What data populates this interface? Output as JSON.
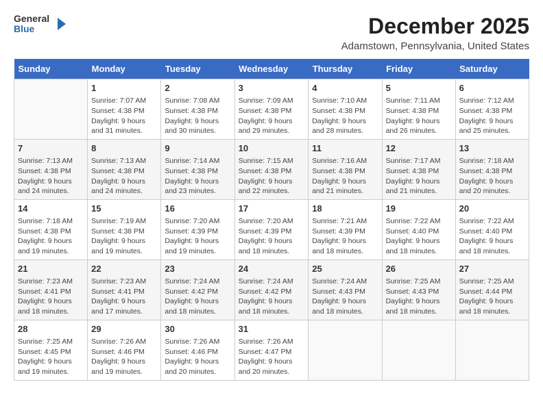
{
  "header": {
    "logo_general": "General",
    "logo_blue": "Blue",
    "title": "December 2025",
    "subtitle": "Adamstown, Pennsylvania, United States"
  },
  "days_of_week": [
    "Sunday",
    "Monday",
    "Tuesday",
    "Wednesday",
    "Thursday",
    "Friday",
    "Saturday"
  ],
  "weeks": [
    [
      {
        "day": "",
        "sunrise": "",
        "sunset": "",
        "daylight": ""
      },
      {
        "day": "1",
        "sunrise": "Sunrise: 7:07 AM",
        "sunset": "Sunset: 4:38 PM",
        "daylight": "Daylight: 9 hours and 31 minutes."
      },
      {
        "day": "2",
        "sunrise": "Sunrise: 7:08 AM",
        "sunset": "Sunset: 4:38 PM",
        "daylight": "Daylight: 9 hours and 30 minutes."
      },
      {
        "day": "3",
        "sunrise": "Sunrise: 7:09 AM",
        "sunset": "Sunset: 4:38 PM",
        "daylight": "Daylight: 9 hours and 29 minutes."
      },
      {
        "day": "4",
        "sunrise": "Sunrise: 7:10 AM",
        "sunset": "Sunset: 4:38 PM",
        "daylight": "Daylight: 9 hours and 28 minutes."
      },
      {
        "day": "5",
        "sunrise": "Sunrise: 7:11 AM",
        "sunset": "Sunset: 4:38 PM",
        "daylight": "Daylight: 9 hours and 26 minutes."
      },
      {
        "day": "6",
        "sunrise": "Sunrise: 7:12 AM",
        "sunset": "Sunset: 4:38 PM",
        "daylight": "Daylight: 9 hours and 25 minutes."
      }
    ],
    [
      {
        "day": "7",
        "sunrise": "Sunrise: 7:13 AM",
        "sunset": "Sunset: 4:38 PM",
        "daylight": "Daylight: 9 hours and 24 minutes."
      },
      {
        "day": "8",
        "sunrise": "Sunrise: 7:13 AM",
        "sunset": "Sunset: 4:38 PM",
        "daylight": "Daylight: 9 hours and 24 minutes."
      },
      {
        "day": "9",
        "sunrise": "Sunrise: 7:14 AM",
        "sunset": "Sunset: 4:38 PM",
        "daylight": "Daylight: 9 hours and 23 minutes."
      },
      {
        "day": "10",
        "sunrise": "Sunrise: 7:15 AM",
        "sunset": "Sunset: 4:38 PM",
        "daylight": "Daylight: 9 hours and 22 minutes."
      },
      {
        "day": "11",
        "sunrise": "Sunrise: 7:16 AM",
        "sunset": "Sunset: 4:38 PM",
        "daylight": "Daylight: 9 hours and 21 minutes."
      },
      {
        "day": "12",
        "sunrise": "Sunrise: 7:17 AM",
        "sunset": "Sunset: 4:38 PM",
        "daylight": "Daylight: 9 hours and 21 minutes."
      },
      {
        "day": "13",
        "sunrise": "Sunrise: 7:18 AM",
        "sunset": "Sunset: 4:38 PM",
        "daylight": "Daylight: 9 hours and 20 minutes."
      }
    ],
    [
      {
        "day": "14",
        "sunrise": "Sunrise: 7:18 AM",
        "sunset": "Sunset: 4:38 PM",
        "daylight": "Daylight: 9 hours and 19 minutes."
      },
      {
        "day": "15",
        "sunrise": "Sunrise: 7:19 AM",
        "sunset": "Sunset: 4:38 PM",
        "daylight": "Daylight: 9 hours and 19 minutes."
      },
      {
        "day": "16",
        "sunrise": "Sunrise: 7:20 AM",
        "sunset": "Sunset: 4:39 PM",
        "daylight": "Daylight: 9 hours and 19 minutes."
      },
      {
        "day": "17",
        "sunrise": "Sunrise: 7:20 AM",
        "sunset": "Sunset: 4:39 PM",
        "daylight": "Daylight: 9 hours and 18 minutes."
      },
      {
        "day": "18",
        "sunrise": "Sunrise: 7:21 AM",
        "sunset": "Sunset: 4:39 PM",
        "daylight": "Daylight: 9 hours and 18 minutes."
      },
      {
        "day": "19",
        "sunrise": "Sunrise: 7:22 AM",
        "sunset": "Sunset: 4:40 PM",
        "daylight": "Daylight: 9 hours and 18 minutes."
      },
      {
        "day": "20",
        "sunrise": "Sunrise: 7:22 AM",
        "sunset": "Sunset: 4:40 PM",
        "daylight": "Daylight: 9 hours and 18 minutes."
      }
    ],
    [
      {
        "day": "21",
        "sunrise": "Sunrise: 7:23 AM",
        "sunset": "Sunset: 4:41 PM",
        "daylight": "Daylight: 9 hours and 18 minutes."
      },
      {
        "day": "22",
        "sunrise": "Sunrise: 7:23 AM",
        "sunset": "Sunset: 4:41 PM",
        "daylight": "Daylight: 9 hours and 17 minutes."
      },
      {
        "day": "23",
        "sunrise": "Sunrise: 7:24 AM",
        "sunset": "Sunset: 4:42 PM",
        "daylight": "Daylight: 9 hours and 18 minutes."
      },
      {
        "day": "24",
        "sunrise": "Sunrise: 7:24 AM",
        "sunset": "Sunset: 4:42 PM",
        "daylight": "Daylight: 9 hours and 18 minutes."
      },
      {
        "day": "25",
        "sunrise": "Sunrise: 7:24 AM",
        "sunset": "Sunset: 4:43 PM",
        "daylight": "Daylight: 9 hours and 18 minutes."
      },
      {
        "day": "26",
        "sunrise": "Sunrise: 7:25 AM",
        "sunset": "Sunset: 4:43 PM",
        "daylight": "Daylight: 9 hours and 18 minutes."
      },
      {
        "day": "27",
        "sunrise": "Sunrise: 7:25 AM",
        "sunset": "Sunset: 4:44 PM",
        "daylight": "Daylight: 9 hours and 18 minutes."
      }
    ],
    [
      {
        "day": "28",
        "sunrise": "Sunrise: 7:25 AM",
        "sunset": "Sunset: 4:45 PM",
        "daylight": "Daylight: 9 hours and 19 minutes."
      },
      {
        "day": "29",
        "sunrise": "Sunrise: 7:26 AM",
        "sunset": "Sunset: 4:46 PM",
        "daylight": "Daylight: 9 hours and 19 minutes."
      },
      {
        "day": "30",
        "sunrise": "Sunrise: 7:26 AM",
        "sunset": "Sunset: 4:46 PM",
        "daylight": "Daylight: 9 hours and 20 minutes."
      },
      {
        "day": "31",
        "sunrise": "Sunrise: 7:26 AM",
        "sunset": "Sunset: 4:47 PM",
        "daylight": "Daylight: 9 hours and 20 minutes."
      },
      {
        "day": "",
        "sunrise": "",
        "sunset": "",
        "daylight": ""
      },
      {
        "day": "",
        "sunrise": "",
        "sunset": "",
        "daylight": ""
      },
      {
        "day": "",
        "sunrise": "",
        "sunset": "",
        "daylight": ""
      }
    ]
  ]
}
